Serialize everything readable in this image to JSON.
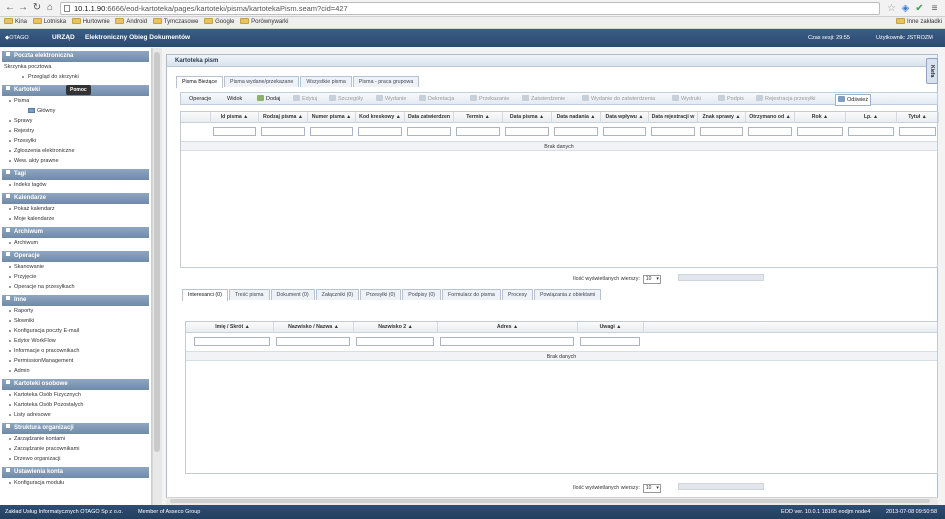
{
  "browser": {
    "url_host": "10.1.1.90",
    "url_path": ":6666/eod-kartoteka/pages/kartoteki/pisma/kartotekaPism.seam?cid=427",
    "bookmarks": [
      "Kina",
      "Lotniska",
      "Hurtownie",
      "Android",
      "Tymczasowe",
      "Google",
      "Porównywarki"
    ],
    "other_bookmarks": "Inne zakładki"
  },
  "header": {
    "brand": "OTAGO",
    "office": "URZĄD",
    "system": "Elektroniczny Obieg Dokumentów",
    "session_label": "Czas sesji: 29:55",
    "user_label": "Użytkownik: JSTROZM"
  },
  "sidebar": {
    "sections": [
      {
        "title": "Poczta elektroniczna",
        "items": [
          {
            "label": "Skrzynka pocztowa",
            "style": "plain"
          },
          {
            "label": "Przegląd do skrzynki",
            "style": "sub"
          }
        ]
      },
      {
        "title": "Kartoteki",
        "tooltip": "Pomoc",
        "items": [
          {
            "label": "Pisma",
            "style": "normal"
          },
          {
            "label": "Główny",
            "style": "tree"
          },
          {
            "label": "Sprawy",
            "style": "normal"
          },
          {
            "label": "Rejestry",
            "style": "normal"
          },
          {
            "label": "Przesyłki",
            "style": "normal"
          },
          {
            "label": "Zgłoszenia elektroniczne",
            "style": "normal"
          },
          {
            "label": "Wew. akty prawne",
            "style": "normal"
          }
        ]
      },
      {
        "title": "Tagi",
        "items": [
          {
            "label": "Indeks tagów",
            "style": "normal"
          }
        ]
      },
      {
        "title": "Kalendarze",
        "items": [
          {
            "label": "Pokaż kalendarz",
            "style": "normal"
          },
          {
            "label": "Moje kalendarze",
            "style": "normal"
          }
        ]
      },
      {
        "title": "Archiwum",
        "items": [
          {
            "label": "Archiwum",
            "style": "normal"
          }
        ]
      },
      {
        "title": "Operacje",
        "items": [
          {
            "label": "Skanowanie",
            "style": "normal"
          },
          {
            "label": "Przyjęcie",
            "style": "normal"
          },
          {
            "label": "Operacje na przesyłkach",
            "style": "normal"
          }
        ]
      },
      {
        "title": "Inne",
        "items": [
          {
            "label": "Raporty",
            "style": "normal"
          },
          {
            "label": "Słowniki",
            "style": "normal"
          },
          {
            "label": "Konfiguracja poczty E-mail",
            "style": "normal"
          },
          {
            "label": "Edytor WorkFlow",
            "style": "normal"
          },
          {
            "label": "Informacje o pracownikach",
            "style": "normal"
          },
          {
            "label": "PermissionManagement",
            "style": "normal"
          },
          {
            "label": "Admin",
            "style": "normal"
          }
        ]
      },
      {
        "title": "Kartoteki osobowe",
        "items": [
          {
            "label": "Kartoteka Osób Fizycznych",
            "style": "normal"
          },
          {
            "label": "Kartoteka Osób Pozostałych",
            "style": "normal"
          },
          {
            "label": "Listy adresowe",
            "style": "normal"
          }
        ]
      },
      {
        "title": "Struktura organizacji",
        "items": [
          {
            "label": "Zarządzanie kontami",
            "style": "normal"
          },
          {
            "label": "Zarządzanie pracownikami",
            "style": "normal"
          },
          {
            "label": "Drzewo organizacji",
            "style": "normal"
          }
        ]
      },
      {
        "title": "Ustawienia konta",
        "items": [
          {
            "label": "Konfiguracja modułu",
            "style": "normal"
          }
        ]
      }
    ]
  },
  "main": {
    "panel_title": "Kartoteka pism",
    "side_tab": "Kiefa",
    "tabs": [
      "Pisma Bieżące",
      "Pisma wydane/przekazane",
      "Wszystkie pisma",
      "Pisma - praca grupowa"
    ],
    "toolbar": [
      {
        "label": "Operacje",
        "icon": "none",
        "state": "on"
      },
      {
        "label": "Widok",
        "icon": "none",
        "state": "on"
      },
      {
        "label": "Dodaj",
        "icon": "plus-icon",
        "state": "on"
      },
      {
        "label": "Edytuj",
        "icon": "edit-icon",
        "state": "off"
      },
      {
        "label": "Szczegóły",
        "icon": "details-icon",
        "state": "off"
      },
      {
        "label": "Wydanie",
        "icon": "issue-icon",
        "state": "off"
      },
      {
        "label": "Dekretacja",
        "icon": "decree-icon",
        "state": "off"
      },
      {
        "label": "Przekazanie",
        "icon": "forward-icon",
        "state": "off"
      },
      {
        "label": "Zatwierdzenie",
        "icon": "approve-icon",
        "state": "off"
      },
      {
        "label": "Wydanie do zatwierdzenia",
        "icon": "issue-approve-icon",
        "state": "off"
      },
      {
        "label": "Wydruki",
        "icon": "print-icon",
        "state": "off"
      },
      {
        "label": "Podpis",
        "icon": "sign-icon",
        "state": "off"
      },
      {
        "label": "Rejestracja przesyłki",
        "icon": "register-icon",
        "state": "off"
      },
      {
        "label": "Odśwież",
        "icon": "refresh-icon",
        "state": "on"
      }
    ],
    "columns": [
      "",
      "Id pisma ▲",
      "Rodzaj pisma ▲",
      "Numer pisma ▲",
      "Kod kreskowy ▲",
      "Data zatwierdzen",
      "Termin ▲",
      "Data pisma ▲",
      "Data nadania ▲",
      "Data wpływu ▲",
      "Data rejestracji w",
      "Znak sprawy ▲",
      "Otrzymano od ▲",
      "Rok ▲",
      "Lp. ▲",
      "Tytuł ▲"
    ],
    "empty_text": "Brak danych",
    "rows_label": "Ilość wyświetlanych wierszy:",
    "rows_value": "10",
    "detail_tabs": [
      "Interesanci (0)",
      "Treść pisma",
      "Dokument (0)",
      "Załączniki (0)",
      "Przesyłki (0)",
      "Podpisy (0)",
      "Formularz do pisma",
      "Procesy",
      "Powiązania z obiektami"
    ],
    "detail_columns": [
      "Imię / Skrót ▲",
      "Nazwisko / Nazwa ▲",
      "Nazwisko 2 ▲",
      "Adres ▲",
      "Uwagi ▲"
    ],
    "detail_empty_text": "Brak danych",
    "detail_rows_label": "Ilość wyświetlanych wierszy:",
    "detail_rows_value": "10"
  },
  "footer": {
    "company": "Zakład Usług Informatycznych OTAGO Sp z o.o.",
    "member": "Member of Asseco Group",
    "version": "EOD ver. 10.0.1 18165 eodjm node4",
    "datetime": "2013-07-08  09:50:58"
  }
}
